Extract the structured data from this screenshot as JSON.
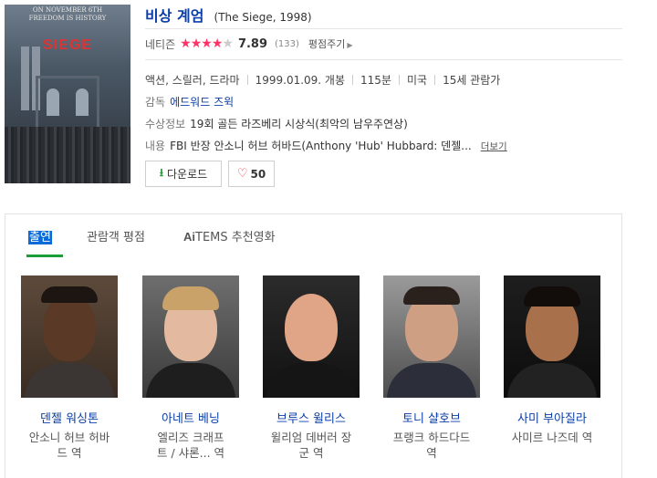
{
  "movie": {
    "title": "비상 계엄",
    "subtitle": "(The Siege, 1998)",
    "poster": {
      "tagline1": "ON NOVEMBER 6TH",
      "tagline2": "FREEDOM IS HISTORY",
      "title": "SIEGE"
    }
  },
  "rating": {
    "label": "네티즌",
    "score": "7.89",
    "stars_filled": 4,
    "stars_total": 5,
    "count": "(133)",
    "rate_link": "평점주기"
  },
  "meta": {
    "genre": "액션, 스릴러, 드라마",
    "release": "1999.01.09. 개봉",
    "runtime": "115분",
    "country": "미국",
    "age": "15세 관람가"
  },
  "director": {
    "label": "감독",
    "value": "에드워드 즈윅"
  },
  "award": {
    "label": "수상정보",
    "value": "19회 골든 라즈베리 시상식(최악의 남우주연상)"
  },
  "plot": {
    "label": "내용",
    "value": "FBI 반장 안소니 허브 허바드(Anthony 'Hub' Hubbard: 덴젤...",
    "more": "더보기"
  },
  "buttons": {
    "download": "다운로드",
    "like_count": "50"
  },
  "tabs": [
    "출연",
    "관람객 평점",
    "TEMS 추천영화"
  ],
  "tabs_ai": "Ai",
  "cast": [
    {
      "name": "덴젤 워싱톤",
      "role_line1": "안소니 허브 허바",
      "role_line2": "드 역"
    },
    {
      "name": "아네트 베닝",
      "role_line1": "엘리즈 크래프",
      "role_line2": "트 / 샤론... 역"
    },
    {
      "name": "브루스 윌리스",
      "role_line1": "윌리엄 데버러 장",
      "role_line2": "군 역"
    },
    {
      "name": "토니 샬호브",
      "role_line1": "프랭크 하드다드",
      "role_line2": "역"
    },
    {
      "name": "사미 부아질라",
      "role_line1": "사미르 나즈데 역",
      "role_line2": ""
    }
  ],
  "colors": {
    "link": "#0a3ea6",
    "star": "#ff3366",
    "tab_active": "#0a6bd8",
    "tab_underline": "#1a9e3a"
  }
}
